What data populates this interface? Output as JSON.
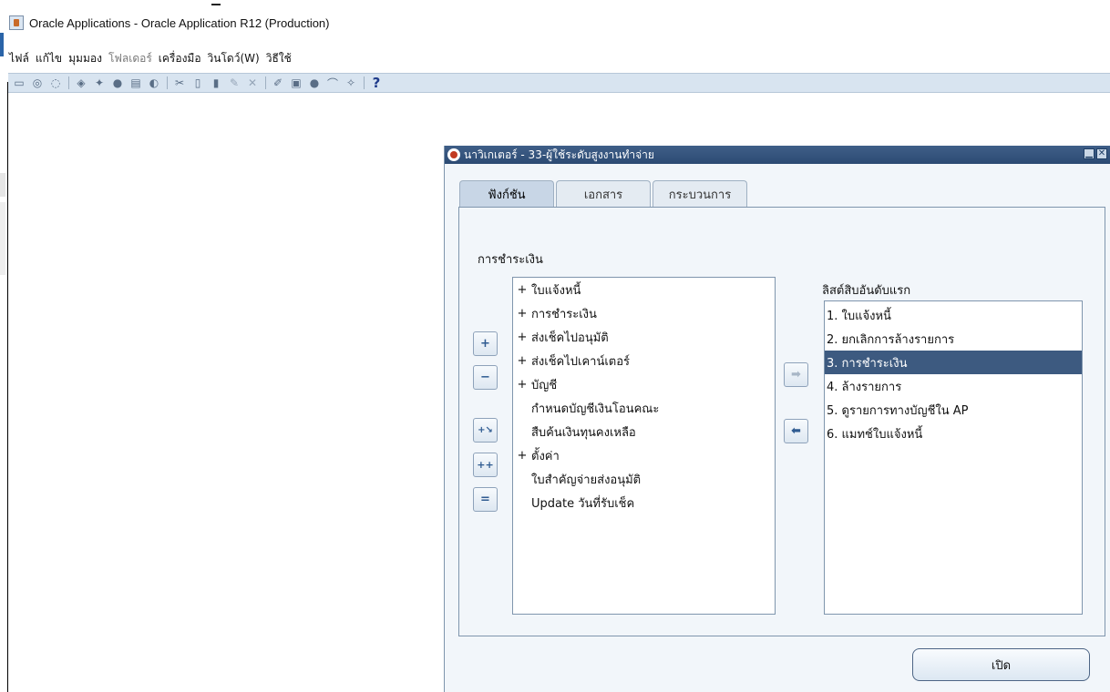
{
  "window": {
    "title": "Oracle Applications - Oracle Application R12 (Production)"
  },
  "menu": [
    {
      "label": "ไฟล์",
      "enabled": true
    },
    {
      "label": "แก้ไข",
      "enabled": true
    },
    {
      "label": "มุมมอง",
      "enabled": true
    },
    {
      "label": "โฟลเดอร์",
      "enabled": false
    },
    {
      "label": "เครื่องมือ",
      "enabled": true
    },
    {
      "label": "วินโดว์(W)",
      "enabled": true
    },
    {
      "label": "วิธีใช้",
      "enabled": true
    }
  ],
  "toolbar": {
    "help_glyph": "?"
  },
  "navigator": {
    "title": "นาวิเกเตอร์ - 33-ผู้ใช้ระดับสูงงานทำจ่าย",
    "minimize_glyph": "▁",
    "close_glyph": "✕",
    "tabs": [
      {
        "label": "ฟังก์ชัน",
        "active": true
      },
      {
        "label": "เอกสาร",
        "active": false
      },
      {
        "label": "กระบวนการ",
        "active": false
      }
    ],
    "section_label": "การชำระเงิน",
    "functions": [
      {
        "expander": "+",
        "label": "ใบแจ้งหนี้"
      },
      {
        "expander": "+",
        "label": "การชำระเงิน"
      },
      {
        "expander": "+",
        "label": "ส่งเช็คไปอนุมัติ"
      },
      {
        "expander": "+",
        "label": "ส่งเช็คไปเคาน์เตอร์"
      },
      {
        "expander": "+",
        "label": "บัญชี"
      },
      {
        "expander": "",
        "label": "กำหนดบัญชีเงินโอนคณะ"
      },
      {
        "expander": "",
        "label": "สืบค้นเงินทุนคงเหลือ"
      },
      {
        "expander": "+",
        "label": "ตั้งค่า"
      },
      {
        "expander": "",
        "label": "ใบสำคัญจ่ายส่งอนุมัติ"
      },
      {
        "expander": "",
        "label": "Update วันที่รับเช็ค"
      }
    ],
    "top_ten_label": "ลิสต์สิบอันดับแรก",
    "top_ten": [
      {
        "label": "1. ใบแจ้งหนี้",
        "selected": false
      },
      {
        "label": "2. ยกเลิกการล้างรายการ",
        "selected": false
      },
      {
        "label": "3. การชำระเงิน",
        "selected": true
      },
      {
        "label": "4. ล้างรายการ",
        "selected": false
      },
      {
        "label": "5. ดูรายการทางบัญชีใน AP",
        "selected": false
      },
      {
        "label": "6. แมทช์ใบแจ้งหนี้",
        "selected": false
      }
    ],
    "buttons": {
      "expand": "+",
      "collapse": "−",
      "expand_branch": "+↘",
      "expand_all": "++",
      "collapse_all": "=",
      "add_to_list": "➡",
      "remove_from_list": "⬅",
      "open": "เปิด"
    }
  }
}
